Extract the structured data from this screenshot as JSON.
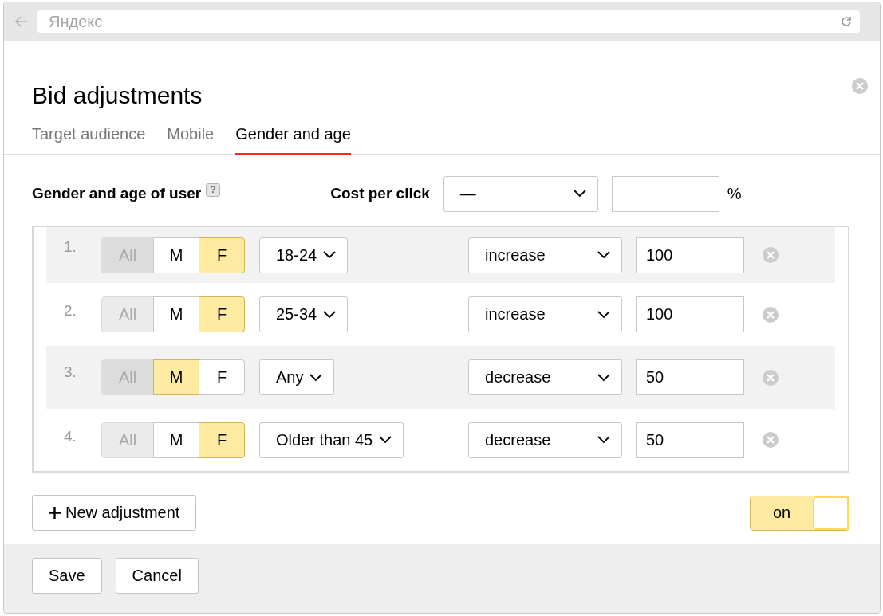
{
  "browser": {
    "address_placeholder": "Яндекс"
  },
  "dialog": {
    "title": "Bid adjustments",
    "tabs": [
      {
        "label": "Target audience",
        "selected": false
      },
      {
        "label": "Mobile",
        "selected": false
      },
      {
        "label": "Gender and age",
        "selected": true
      }
    ],
    "header": {
      "label": "Gender and age of user",
      "help": "?",
      "cost_label": "Cost per click",
      "cost_select": "—",
      "percent_sign": "%"
    },
    "rows": [
      {
        "number": "1.",
        "genders": [
          {
            "label": "All",
            "selected": false,
            "disabled": true
          },
          {
            "label": "M",
            "selected": false,
            "disabled": false
          },
          {
            "label": "F",
            "selected": true,
            "disabled": false
          }
        ],
        "age": "18-24",
        "action": "increase",
        "value": "100"
      },
      {
        "number": "2.",
        "genders": [
          {
            "label": "All",
            "selected": false,
            "disabled": true
          },
          {
            "label": "M",
            "selected": false,
            "disabled": false
          },
          {
            "label": "F",
            "selected": true,
            "disabled": false
          }
        ],
        "age": "25-34",
        "action": "increase",
        "value": "100"
      },
      {
        "number": "3.",
        "genders": [
          {
            "label": "All",
            "selected": false,
            "disabled": true
          },
          {
            "label": "M",
            "selected": true,
            "disabled": false
          },
          {
            "label": "F",
            "selected": false,
            "disabled": false
          }
        ],
        "age": "Any",
        "action": "decrease",
        "value": "50"
      },
      {
        "number": "4.",
        "genders": [
          {
            "label": "All",
            "selected": false,
            "disabled": true
          },
          {
            "label": "M",
            "selected": false,
            "disabled": false
          },
          {
            "label": "F",
            "selected": true,
            "disabled": false
          }
        ],
        "age": "Older than 45",
        "action": "decrease",
        "value": "50"
      }
    ],
    "new_button": "New adjustment",
    "toggle": {
      "label": "on",
      "on": true
    },
    "buttons": [
      "Save",
      "Cancel"
    ]
  }
}
